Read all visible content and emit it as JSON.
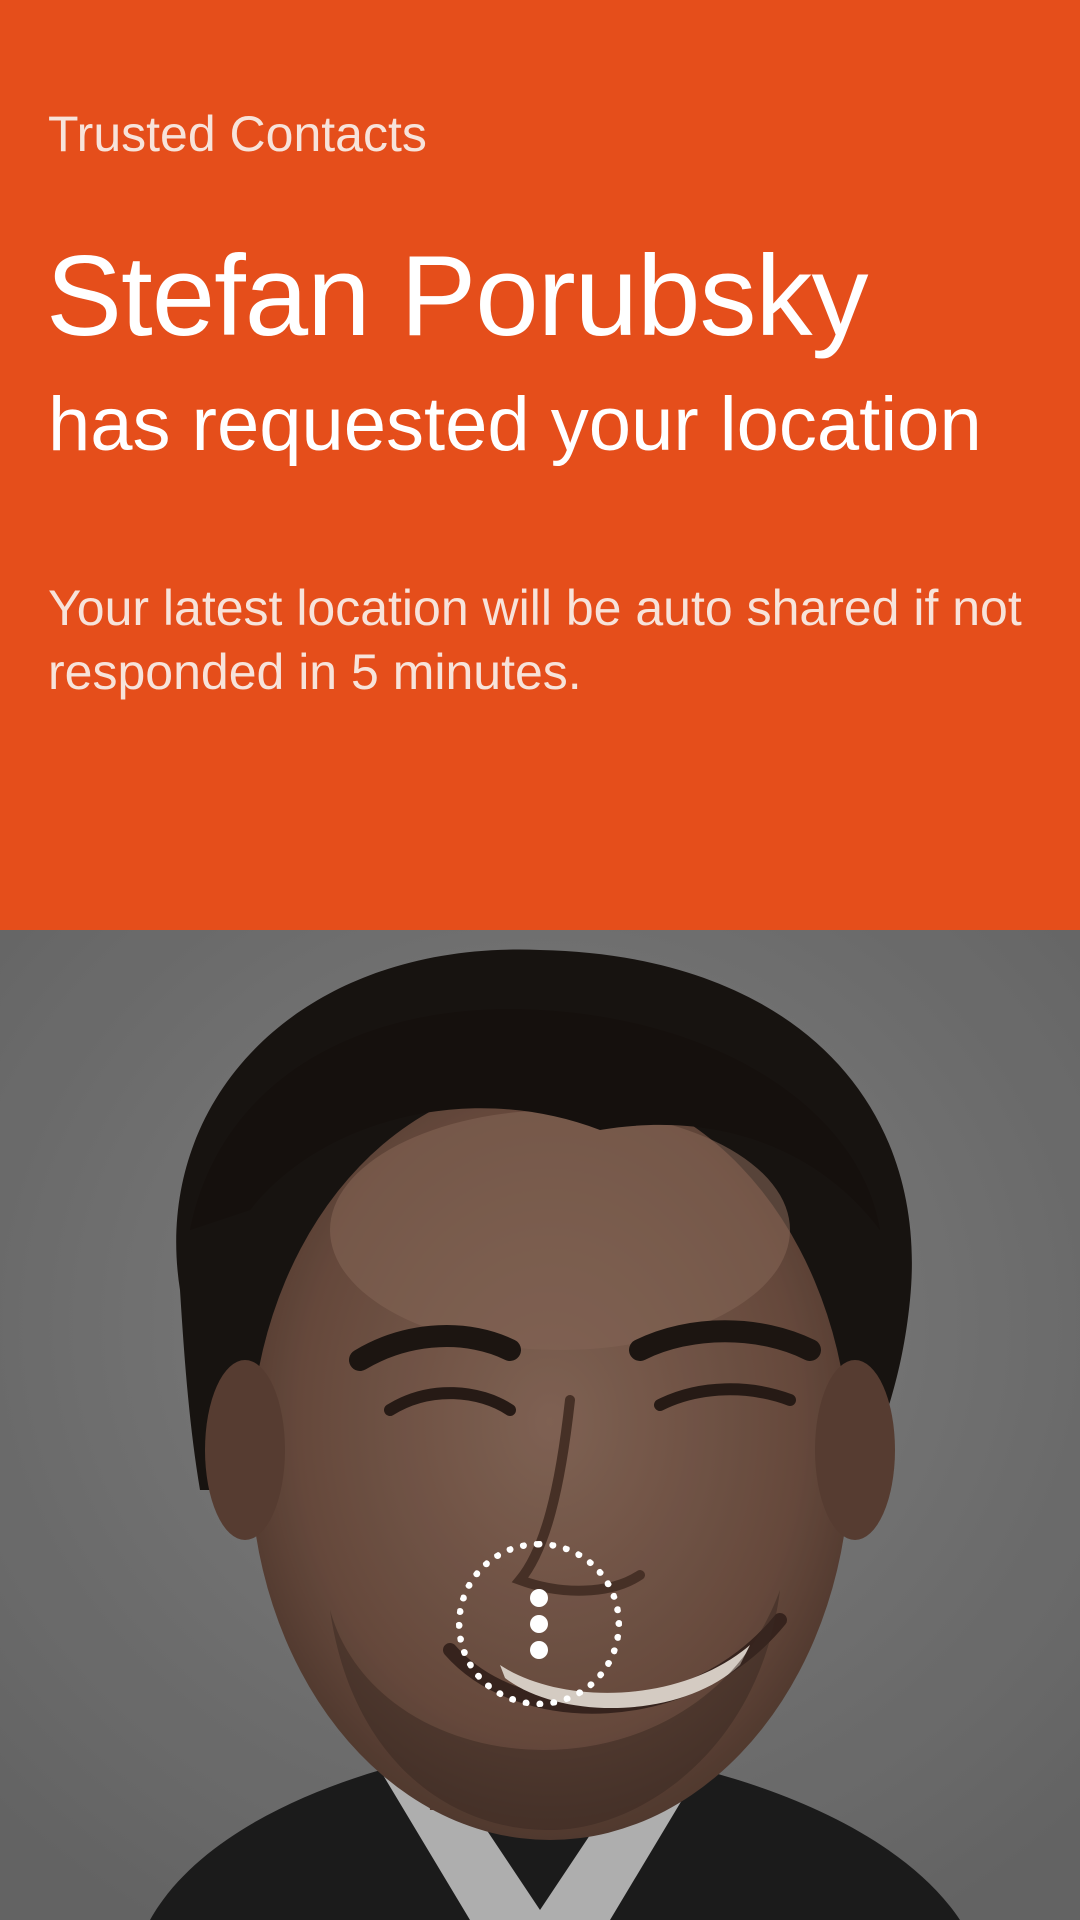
{
  "header": {
    "app_title": "Trusted Contacts",
    "contact_name": "Stefan Porubsky",
    "request_text": "has requested your location",
    "auto_share_notice": "Your latest location will be auto shared if not responded in 5 minutes."
  },
  "photo": {
    "icon": "contact-photo"
  },
  "actions": {
    "overflow_icon": "more-vert-icon"
  },
  "colors": {
    "accent": "#e54e1b",
    "photo_backdrop": "#7b7b7b",
    "on_accent": "#ffffff"
  }
}
